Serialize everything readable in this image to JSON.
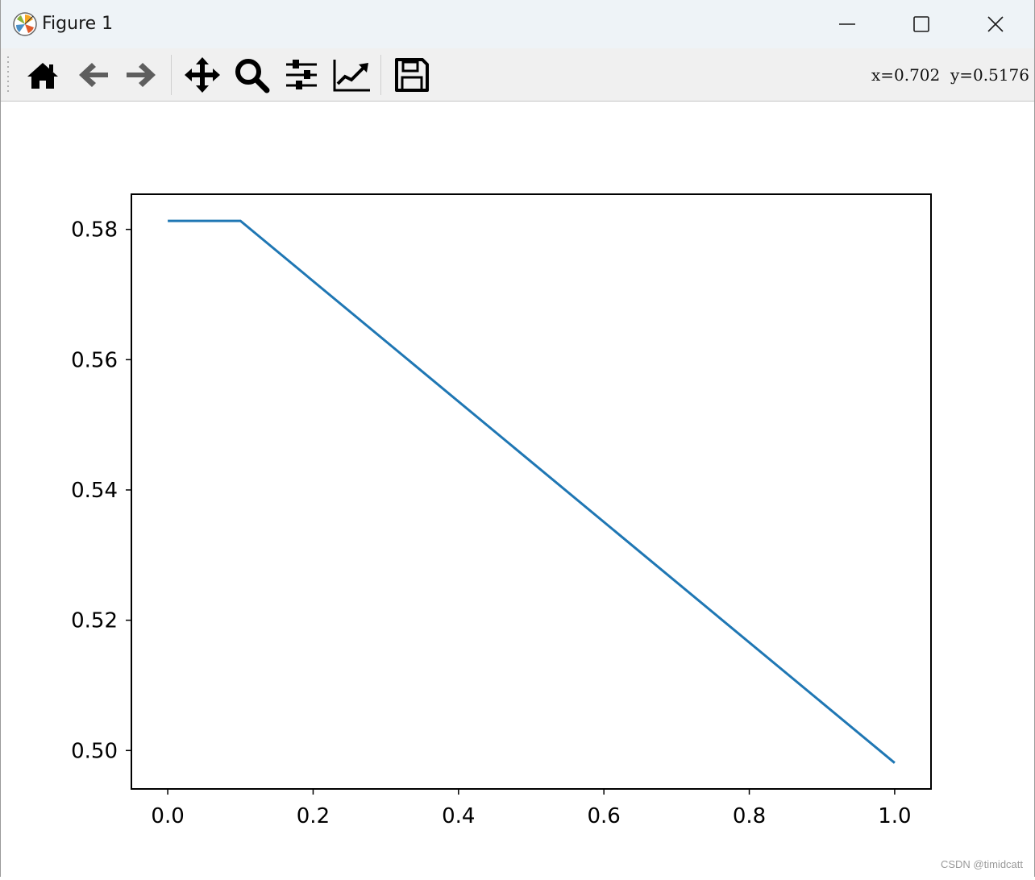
{
  "window": {
    "title": "Figure 1",
    "app_icon": "matplotlib-logo",
    "controls": [
      {
        "name": "minimize",
        "icon": "minimize-icon"
      },
      {
        "name": "maximize",
        "icon": "maximize-icon"
      },
      {
        "name": "close",
        "icon": "close-icon"
      }
    ]
  },
  "toolbar": {
    "buttons": [
      {
        "name": "home",
        "icon": "home-icon"
      },
      {
        "name": "back",
        "icon": "back-arrow-icon"
      },
      {
        "name": "forward",
        "icon": "forward-arrow-icon"
      },
      {
        "name": "pan",
        "icon": "pan-move-icon"
      },
      {
        "name": "zoom",
        "icon": "zoom-magnifier-icon"
      },
      {
        "name": "configure-subplots",
        "icon": "sliders-icon"
      },
      {
        "name": "edit-axes",
        "icon": "line-chart-icon"
      },
      {
        "name": "save",
        "icon": "save-floppy-icon"
      }
    ],
    "coords_text": "x=0.702  y=0.5176"
  },
  "colors": {
    "line": "#1f77b4",
    "titlebar": "#eef3f7",
    "toolbar": "#f0f0f0"
  },
  "chart_data": {
    "type": "line",
    "title": "",
    "xlabel": "",
    "ylabel": "",
    "x": [
      0.0,
      0.1,
      1.0
    ],
    "series": [
      {
        "values": [
          0.5813,
          0.5813,
          0.4981
        ]
      }
    ],
    "xlim": [
      -0.05,
      1.05
    ],
    "ylim": [
      0.4941,
      0.5854
    ],
    "xticks": [
      0.0,
      0.2,
      0.4,
      0.6,
      0.8,
      1.0
    ],
    "xtick_labels": [
      "0.0",
      "0.2",
      "0.4",
      "0.6",
      "0.8",
      "1.0"
    ],
    "yticks": [
      0.5,
      0.52,
      0.54,
      0.56,
      0.58
    ],
    "ytick_labels": [
      "0.50",
      "0.52",
      "0.54",
      "0.56",
      "0.58"
    ],
    "grid": false,
    "legend": false
  },
  "watermark": "CSDN @timidcatt"
}
